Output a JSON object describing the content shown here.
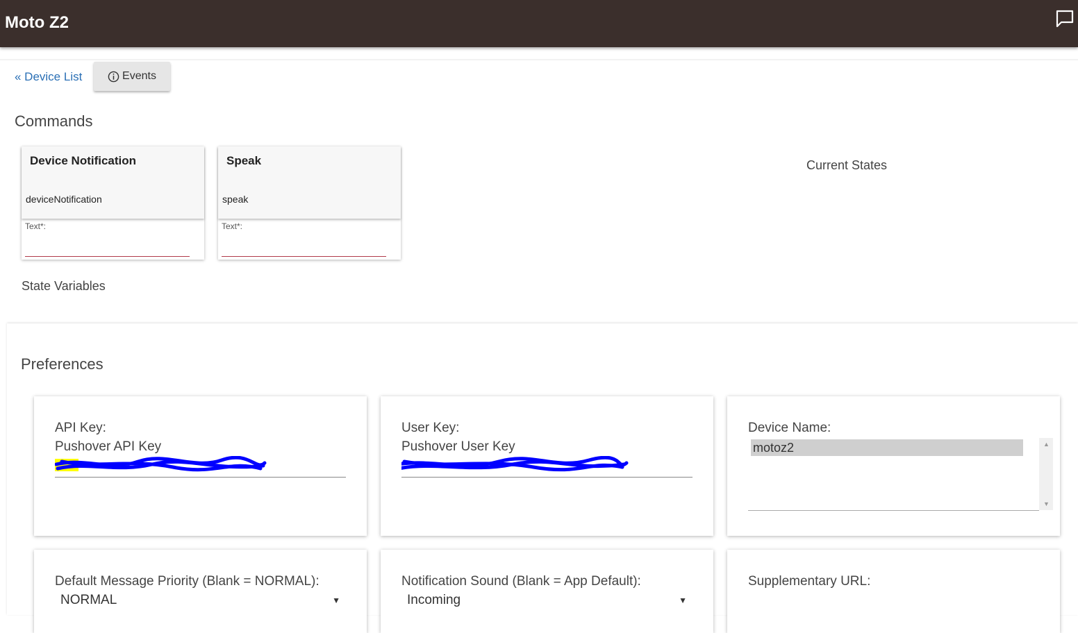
{
  "header": {
    "title": "Moto Z2",
    "chat_icon": "chat-bubble-icon"
  },
  "nav": {
    "device_list": "« Device List",
    "events": "Events",
    "events_icon": "info-icon"
  },
  "commands": {
    "heading": "Commands",
    "items": [
      {
        "name": "Device Notification",
        "method": "deviceNotification",
        "param_label": "Text*:",
        "value": ""
      },
      {
        "name": "Speak",
        "method": "speak",
        "param_label": "Text*:",
        "value": ""
      }
    ]
  },
  "current_states": {
    "heading": "Current States"
  },
  "state_variables": {
    "heading": "State Variables"
  },
  "preferences": {
    "heading": "Preferences",
    "api_key": {
      "label": "API Key:",
      "sublabel": "Pushover API Key"
    },
    "user_key": {
      "label": "User Key:",
      "sublabel": "Pushover User Key"
    },
    "device_name": {
      "label": "Device Name:",
      "selected": "motoz2"
    },
    "priority": {
      "label": "Default Message Priority (Blank = NORMAL):",
      "value": "NORMAL"
    },
    "sound": {
      "label": "Notification Sound (Blank = App Default):",
      "value": "Incoming"
    },
    "supp_url": {
      "label": "Supplementary URL:"
    }
  },
  "colors": {
    "header_bg": "#3b2f2c",
    "link": "#2a6fb5",
    "redaction": "#0000ff",
    "highlight": "#ffff00"
  }
}
